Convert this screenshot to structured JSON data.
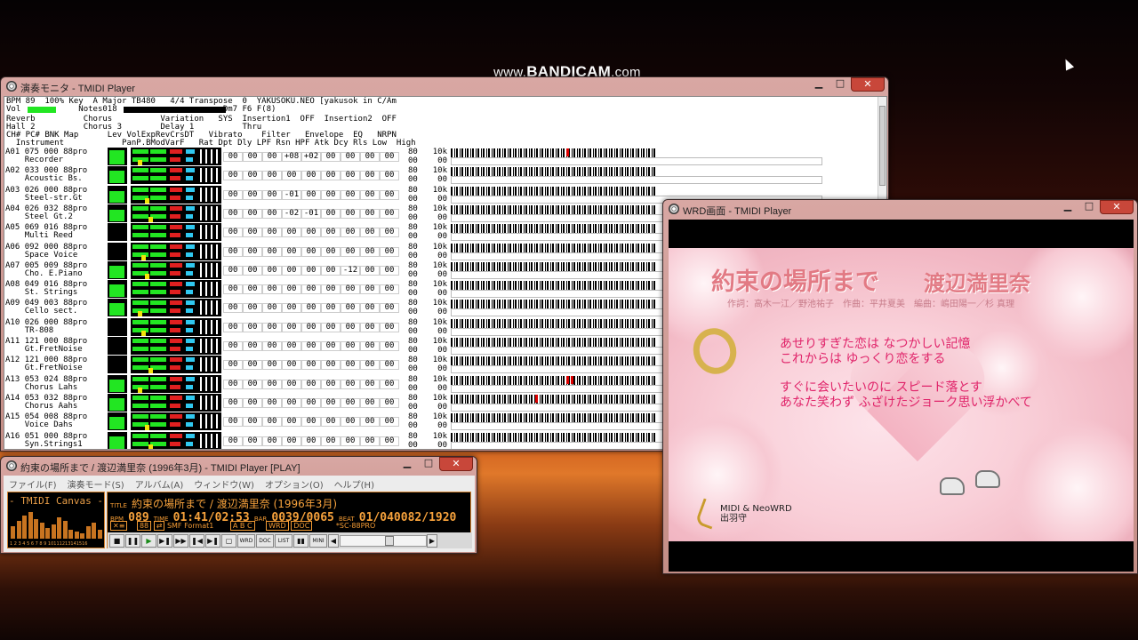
{
  "watermark": {
    "pre": "www.",
    "brand": "BANDICAM",
    "post": ".com"
  },
  "monitor": {
    "title": "演奏モニタ - TMIDI Player",
    "status_line1": "BPM 89  100% Key  A Major TB480   4/4 Transpose  0  YAKUSOKU.NEO [yakusok in C/Am",
    "status_line2": "Vol            Notes018                      Dm7 F6 F(8)",
    "effect_line1": "Reverb          Chorus          Variation   SYS  Insertion1  OFF  Insertion2  OFF",
    "effect_line2": "Hall 2          Chorus 3        Delay 1          Thru",
    "header_line1": "CH# PC# BNK Map      Lev VolExpRevCrsDT   Vibrato    Filter   Envelope  EQ   NRPN",
    "header_line2": "  Instrument            PanP.BModVarF   Rat Dpt Dly LPF Rsn HPF Atk Dcy Rls Low  High",
    "channels": [
      {
        "ch": "A01",
        "pc": "075",
        "bnk": "000",
        "map": "88pro",
        "inst": "Recorder",
        "lev": 0.9,
        "vals": [
          "00",
          "00",
          "00",
          "+08",
          "+02",
          "00",
          "00",
          "00",
          "00"
        ],
        "eq": [
          "80",
          "00",
          "10k",
          "00"
        ],
        "notes": [
          130
        ]
      },
      {
        "ch": "A02",
        "pc": "033",
        "bnk": "000",
        "map": "88pro",
        "inst": "Acoustic Bs.",
        "lev": 0.8,
        "vals": [
          "00",
          "00",
          "00",
          "00",
          "00",
          "00",
          "00",
          "00",
          "00"
        ],
        "eq": [
          "80",
          "00",
          "10k",
          "00"
        ],
        "notes": []
      },
      {
        "ch": "A03",
        "pc": "026",
        "bnk": "000",
        "map": "88pro",
        "inst": "Steel-str.Gt",
        "lev": 0.7,
        "vals": [
          "00",
          "00",
          "00",
          "-01",
          "00",
          "00",
          "00",
          "00",
          "00"
        ],
        "eq": [
          "80",
          "00",
          "10k",
          "00"
        ],
        "notes": []
      },
      {
        "ch": "A04",
        "pc": "026",
        "bnk": "032",
        "map": "88pro",
        "inst": "Steel Gt.2",
        "lev": 0.7,
        "vals": [
          "00",
          "00",
          "00",
          "-02",
          "-01",
          "00",
          "00",
          "00",
          "00"
        ],
        "eq": [
          "80",
          "00",
          "10k",
          "00"
        ],
        "notes": []
      },
      {
        "ch": "A05",
        "pc": "069",
        "bnk": "016",
        "map": "88pro",
        "inst": "Multi Reed",
        "lev": 0.0,
        "vals": [
          "00",
          "00",
          "00",
          "00",
          "00",
          "00",
          "00",
          "00",
          "00"
        ],
        "eq": [
          "80",
          "00",
          "10k",
          "00"
        ],
        "notes": []
      },
      {
        "ch": "A06",
        "pc": "092",
        "bnk": "000",
        "map": "88pro",
        "inst": "Space Voice",
        "lev": 0.0,
        "vals": [
          "00",
          "00",
          "00",
          "00",
          "00",
          "00",
          "00",
          "00",
          "00"
        ],
        "eq": [
          "80",
          "00",
          "10k",
          "00"
        ],
        "notes": []
      },
      {
        "ch": "A07",
        "pc": "005",
        "bnk": "009",
        "map": "88pro",
        "inst": "Cho. E.Piano",
        "lev": 0.8,
        "vals": [
          "00",
          "00",
          "00",
          "00",
          "00",
          "00",
          "-12",
          "00",
          "00"
        ],
        "eq": [
          "80",
          "00",
          "10k",
          "00"
        ],
        "notes": []
      },
      {
        "ch": "A08",
        "pc": "049",
        "bnk": "016",
        "map": "88pro",
        "inst": "St. Strings",
        "lev": 0.8,
        "vals": [
          "00",
          "00",
          "00",
          "00",
          "00",
          "00",
          "00",
          "00",
          "00"
        ],
        "eq": [
          "80",
          "00",
          "10k",
          "00"
        ],
        "notes": []
      },
      {
        "ch": "A09",
        "pc": "049",
        "bnk": "003",
        "map": "88pro",
        "inst": "Cello sect.",
        "lev": 0.8,
        "vals": [
          "00",
          "00",
          "00",
          "00",
          "00",
          "00",
          "00",
          "00",
          "00"
        ],
        "eq": [
          "80",
          "00",
          "10k",
          "00"
        ],
        "notes": []
      },
      {
        "ch": "A10",
        "pc": "026",
        "bnk": "000",
        "map": "88pro",
        "inst": "TR-808",
        "lev": 0.0,
        "vals": [
          "00",
          "00",
          "00",
          "00",
          "00",
          "00",
          "00",
          "00",
          "00"
        ],
        "eq": [
          "80",
          "00",
          "10k",
          "00"
        ],
        "notes": []
      },
      {
        "ch": "A11",
        "pc": "121",
        "bnk": "000",
        "map": "88pro",
        "inst": "Gt.FretNoise",
        "lev": 0.0,
        "vals": [
          "00",
          "00",
          "00",
          "00",
          "00",
          "00",
          "00",
          "00",
          "00"
        ],
        "eq": [
          "80",
          "00",
          "10k",
          "00"
        ],
        "notes": []
      },
      {
        "ch": "A12",
        "pc": "121",
        "bnk": "000",
        "map": "88pro",
        "inst": "Gt.FretNoise",
        "lev": 0.0,
        "vals": [
          "00",
          "00",
          "00",
          "00",
          "00",
          "00",
          "00",
          "00",
          "00"
        ],
        "eq": [
          "80",
          "00",
          "10k",
          "00"
        ],
        "notes": []
      },
      {
        "ch": "A13",
        "pc": "053",
        "bnk": "024",
        "map": "88pro",
        "inst": "Chorus Lahs",
        "lev": 0.8,
        "vals": [
          "00",
          "00",
          "00",
          "00",
          "00",
          "00",
          "00",
          "00",
          "00"
        ],
        "eq": [
          "80",
          "00",
          "10k",
          "00"
        ],
        "notes": [
          130,
          135
        ]
      },
      {
        "ch": "A14",
        "pc": "053",
        "bnk": "032",
        "map": "88pro",
        "inst": "Chorus Aahs",
        "lev": 0.8,
        "vals": [
          "00",
          "00",
          "00",
          "00",
          "00",
          "00",
          "00",
          "00",
          "00"
        ],
        "eq": [
          "80",
          "00",
          "10k",
          "00"
        ],
        "notes": [
          95
        ]
      },
      {
        "ch": "A15",
        "pc": "054",
        "bnk": "008",
        "map": "88pro",
        "inst": "Voice Dahs",
        "lev": 0.8,
        "vals": [
          "00",
          "00",
          "00",
          "00",
          "00",
          "00",
          "00",
          "00",
          "00"
        ],
        "eq": [
          "80",
          "00",
          "10k",
          "00"
        ],
        "notes": []
      },
      {
        "ch": "A16",
        "pc": "051",
        "bnk": "000",
        "map": "88pro",
        "inst": "Syn.Strings1",
        "lev": 0.8,
        "vals": [
          "00",
          "00",
          "00",
          "00",
          "00",
          "00",
          "00",
          "00",
          "00"
        ],
        "eq": [
          "80",
          "00",
          "10k",
          "00"
        ],
        "notes": []
      }
    ]
  },
  "player": {
    "title": "約束の場所まで / 渡辺満里奈 (1996年3月) - TMIDI Player [PLAY]",
    "menu": [
      "ファイル(F)",
      "演奏モード(S)",
      "アルバム(A)",
      "ウィンドウ(W)",
      "オプション(O)",
      "ヘルプ(H)"
    ],
    "canvas_title": "- TMIDI Canvas -",
    "canvas_nums": "1 2 3 4 5 6 7 8 9 10111213141516",
    "track_title": "約束の場所まで / 渡辺満里奈 (1996年3月)",
    "lbl_title": "TITLE",
    "lbl_bpm": "BPM",
    "lbl_time": "TIME",
    "lbl_bar": "BAR",
    "lbl_beat": "BEAT",
    "bpm": "089",
    "time": "01:41/02:53",
    "bar": "0039/0065",
    "beat": "01/040082/1920",
    "format": "SMF Format1",
    "abc": "A B C",
    "wrd": "WRD",
    "doc": "DOC",
    "module": "*SC-88PRO",
    "num88": "88",
    "buttons": [
      "■",
      "❚❚",
      "▶",
      "▶❚",
      "▶▶",
      "❚◀",
      "▶❚",
      "▢",
      "WRD",
      "DOC",
      "LIST",
      "▮▮",
      "MINI",
      "◀",
      "▶"
    ],
    "progress": 0.58
  },
  "wrd": {
    "title": "WRD画面 - TMIDI Player",
    "song": "約束の場所まで",
    "artist": "渡辺満里奈",
    "credits": "作詞：高木一江／野池祐子　作曲：平井夏美　編曲：嶋田陽一／杉 真理",
    "lyrics": [
      "あせりすぎた恋は なつかしい記憶",
      "これからは ゆっくり恋をする",
      "すぐに会いたいのに スピード落とす",
      "あなた笑わず ふざけたジョーク思い浮かべて"
    ],
    "logo_line1": "MIDI & NeoWRD",
    "logo_line2": "出羽守"
  },
  "colors": {
    "level": "#22e622",
    "accent_orange": "#f29a34",
    "pan": "#22e622",
    "rev": "#e02020",
    "mod": "#30c8f0",
    "yellow": "#f2e20a"
  }
}
